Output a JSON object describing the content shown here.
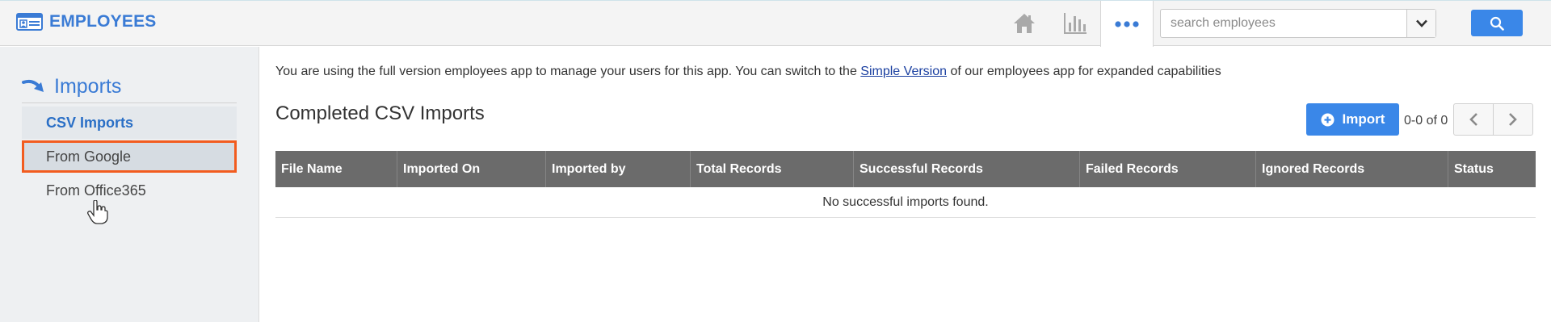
{
  "app": {
    "title": "EMPLOYEES"
  },
  "header": {
    "icons": [
      "home-icon",
      "bar-chart-icon",
      "more-dots-icon"
    ],
    "search": {
      "placeholder": "search employees",
      "value": ""
    }
  },
  "sidebar": {
    "heading": "Imports",
    "items": [
      {
        "label": "CSV Imports",
        "active": true
      },
      {
        "label": "From Google",
        "active": false
      },
      {
        "label": "From Office365",
        "active": false
      }
    ]
  },
  "main": {
    "notice": {
      "before": "You are using the full version employees app to manage your users for this app. You can switch to the ",
      "link": "Simple Version",
      "after": " of our employees app for expanded capabilities"
    },
    "title": "Completed CSV Imports",
    "import_label": "Import",
    "pager": "0-0 of 0",
    "columns": [
      "File Name",
      "Imported On",
      "Imported by",
      "Total Records",
      "Successful Records",
      "Failed Records",
      "Ignored Records",
      "Status"
    ],
    "empty_message": "No successful imports found."
  },
  "colors": {
    "accent": "#3a7bd5",
    "button": "#3a87e8",
    "table_header": "#6b6b6b",
    "highlight_border": "#f25c1f"
  }
}
